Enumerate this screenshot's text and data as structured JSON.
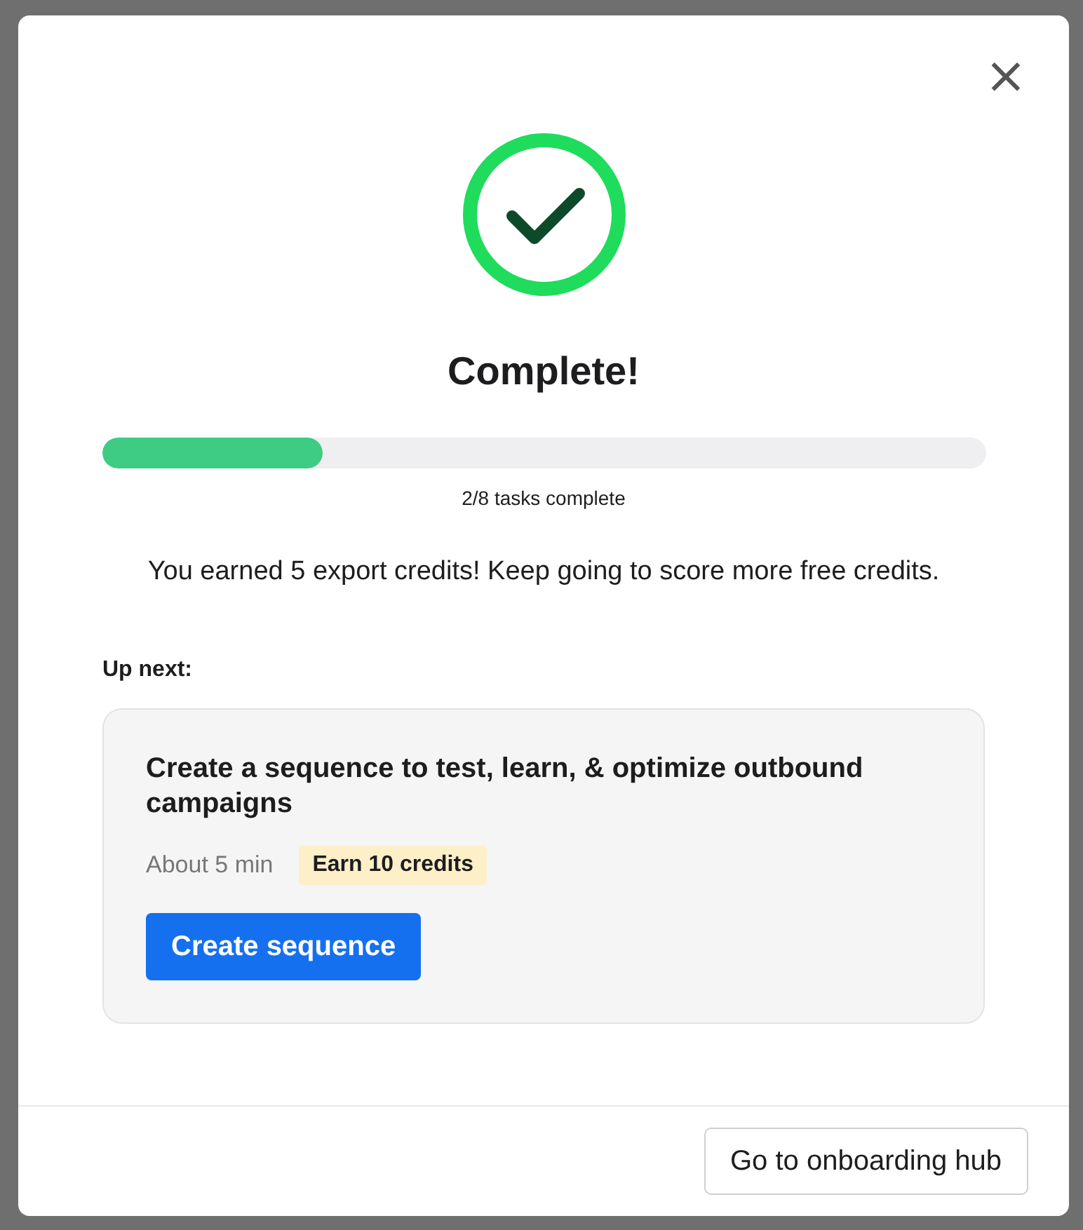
{
  "dialog": {
    "close_label": "×",
    "title": "Complete!",
    "progress": {
      "level": 0.25,
      "caption": "2/8 tasks complete"
    },
    "message": "You earned 5 export credits! Keep going to score more free credits.",
    "up_next_label": "Up next:",
    "next_task": {
      "title": "Create a sequence to test, learn, & optimize outbound campaigns",
      "duration": "About 5 min",
      "reward": "Earn 10 credits",
      "action": "Create sequence"
    },
    "footer_button": "Go to onboarding hub"
  }
}
